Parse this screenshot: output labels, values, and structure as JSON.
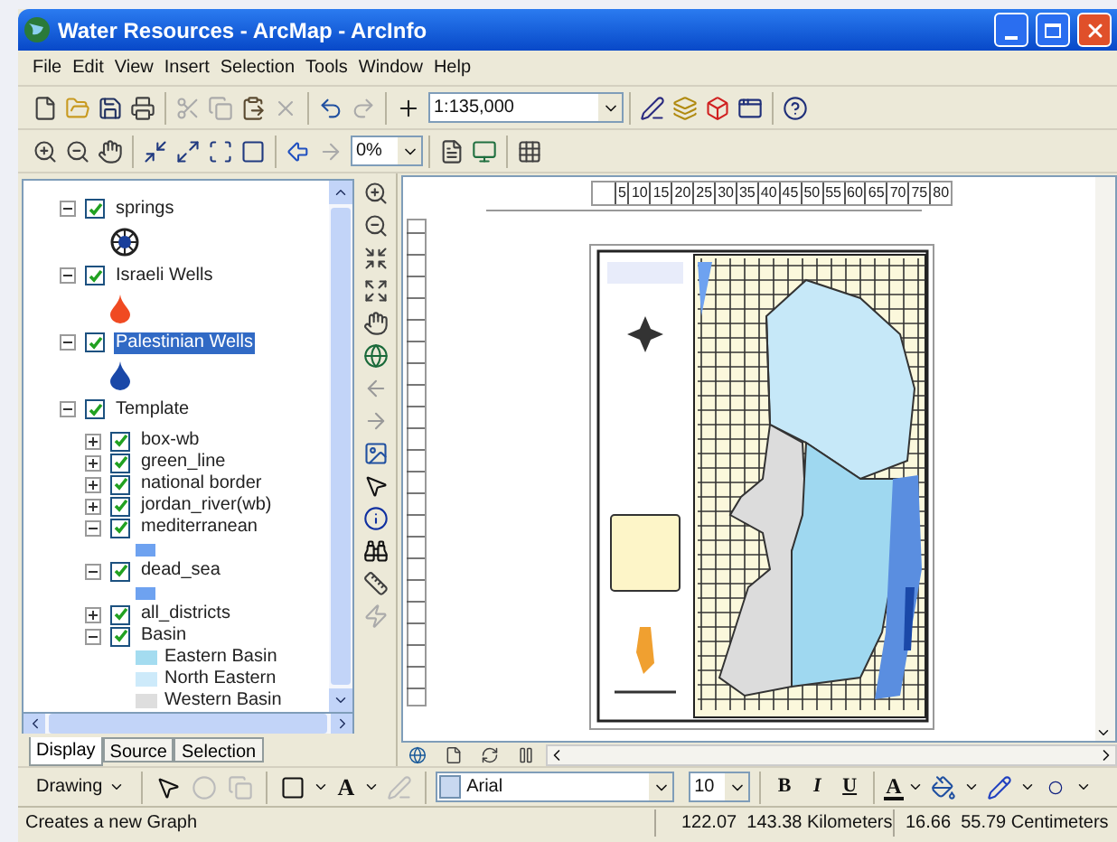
{
  "window": {
    "title": "Water Resources - ArcMap - ArcInfo"
  },
  "menu": [
    "File",
    "Edit",
    "View",
    "Insert",
    "Selection",
    "Tools",
    "Window",
    "Help"
  ],
  "standard_toolbar": {
    "scale": "1:135,000"
  },
  "layout_toolbar": {
    "zoom_percent": "0%"
  },
  "toc": {
    "layers": [
      {
        "name": "springs",
        "checked": true,
        "expanded": true,
        "selected": false,
        "symbol": {
          "kind": "spring",
          "color": "#1a3f9a"
        }
      },
      {
        "name": "Israeli Wells",
        "checked": true,
        "expanded": true,
        "selected": false,
        "symbol": {
          "kind": "drop",
          "color": "#f04a22"
        }
      },
      {
        "name": "Palestinian Wells",
        "checked": true,
        "expanded": true,
        "selected": true,
        "symbol": {
          "kind": "drop",
          "color": "#1a48a8"
        }
      },
      {
        "name": "Template",
        "checked": true,
        "expanded": true,
        "selected": false,
        "children": [
          {
            "name": "box-wb",
            "checked": true,
            "expanded": false,
            "selected": false
          },
          {
            "name": "green_line",
            "checked": true,
            "expanded": false,
            "selected": false
          },
          {
            "name": "national border",
            "checked": true,
            "expanded": false,
            "selected": false
          },
          {
            "name": "jordan_river(wb)",
            "checked": true,
            "expanded": false,
            "selected": false
          },
          {
            "name": "mediterranean",
            "checked": true,
            "expanded": true,
            "selected": false,
            "symbol": {
              "kind": "swatch",
              "color": "#6ea2f0"
            }
          },
          {
            "name": "dead_sea",
            "checked": true,
            "expanded": true,
            "selected": false,
            "symbol": {
              "kind": "swatch",
              "color": "#6ea2f0"
            }
          },
          {
            "name": "all_districts",
            "checked": true,
            "expanded": false,
            "selected": false
          },
          {
            "name": "Basin",
            "checked": true,
            "expanded": true,
            "selected": false,
            "classes": [
              {
                "label": "Eastern Basin",
                "color": "#a4dcf0"
              },
              {
                "label": "North Eastern",
                "color": "#cdeafa"
              },
              {
                "label": "Western Basin",
                "color": "#dedede"
              }
            ]
          }
        ]
      }
    ]
  },
  "toc_tabs": [
    {
      "label": "Display",
      "selected": true
    },
    {
      "label": "Source",
      "selected": false
    },
    {
      "label": "Selection",
      "selected": false
    }
  ],
  "map_view": {
    "ruler_labels": [
      "5",
      "10",
      "15",
      "20",
      "25",
      "30",
      "35",
      "40",
      "45",
      "50",
      "55",
      "60",
      "65",
      "70",
      "75",
      "80"
    ]
  },
  "drawing_toolbar": {
    "menu": "Drawing",
    "text_tool": "A",
    "font": "Arial",
    "size": "10",
    "styles": [
      "B",
      "I",
      "U"
    ],
    "font_color_tool": "A"
  },
  "status_bar": {
    "message": "Creates a new Graph",
    "map_position": "122.07  143.38 Kilometers",
    "page_position": "16.66  55.79 Centimeters"
  }
}
